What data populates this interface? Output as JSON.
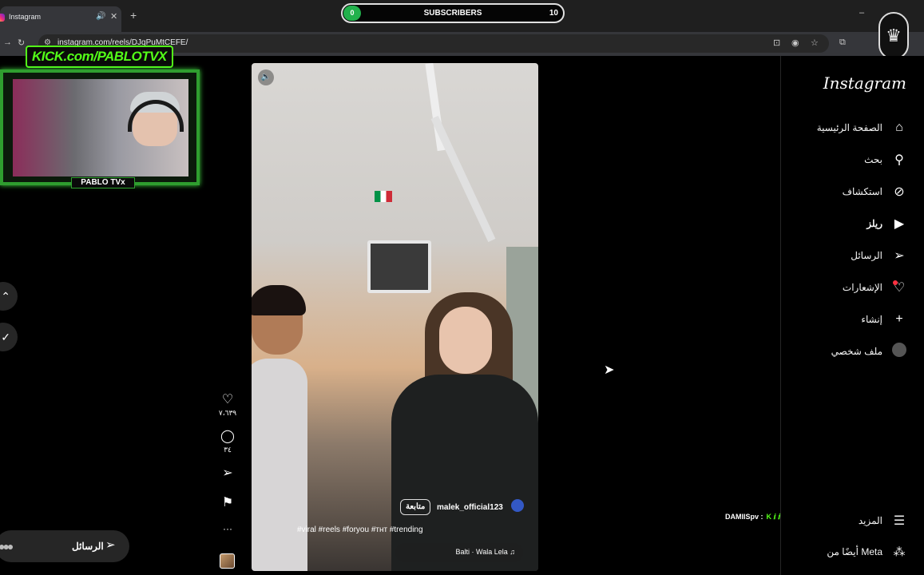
{
  "browser": {
    "tab_title": "Instagram",
    "tab_sound_icon": "speaker-icon",
    "url": "instagram.com/reels/DJqPuMtCEFE/"
  },
  "sub_counter": {
    "current": "0",
    "label": "SUBSCRIBERS",
    "goal": "10",
    "accent": "#22b14c"
  },
  "stream_overlay": {
    "kick_logo_text": "KICK.com/PABLOTVX",
    "cam_label": "PABLO TVx",
    "accent": "#53fc18"
  },
  "instagram": {
    "logo": "Instagram",
    "nav": [
      {
        "label": "الصفحة الرئيسية",
        "icon": "home-icon"
      },
      {
        "label": "بحث",
        "icon": "search-icon"
      },
      {
        "label": "استكشاف",
        "icon": "compass-icon"
      },
      {
        "label": "ريلز",
        "icon": "reels-icon"
      },
      {
        "label": "الرسائل",
        "icon": "send-icon"
      },
      {
        "label": "الإشعارات",
        "icon": "heart-icon"
      },
      {
        "label": "إنشاء",
        "icon": "plus-icon"
      },
      {
        "label": "ملف شخصي",
        "icon": "avatar-icon"
      }
    ],
    "more": "المزيد",
    "also_from_meta": "أيضًا من Meta",
    "notification_color": "#ff3040"
  },
  "reel": {
    "author": "malek_official123",
    "follow": "متابعة",
    "caption": "#viral #reels #foryou #тнт #trending",
    "music": "Balti · Wala Lela ♫",
    "likes": "٧،٦٣٩",
    "comments": "٣٤",
    "more": "···"
  },
  "messages_pill": {
    "label": "الرسائل"
  },
  "chat": {
    "line": "DAMIISpv :"
  }
}
